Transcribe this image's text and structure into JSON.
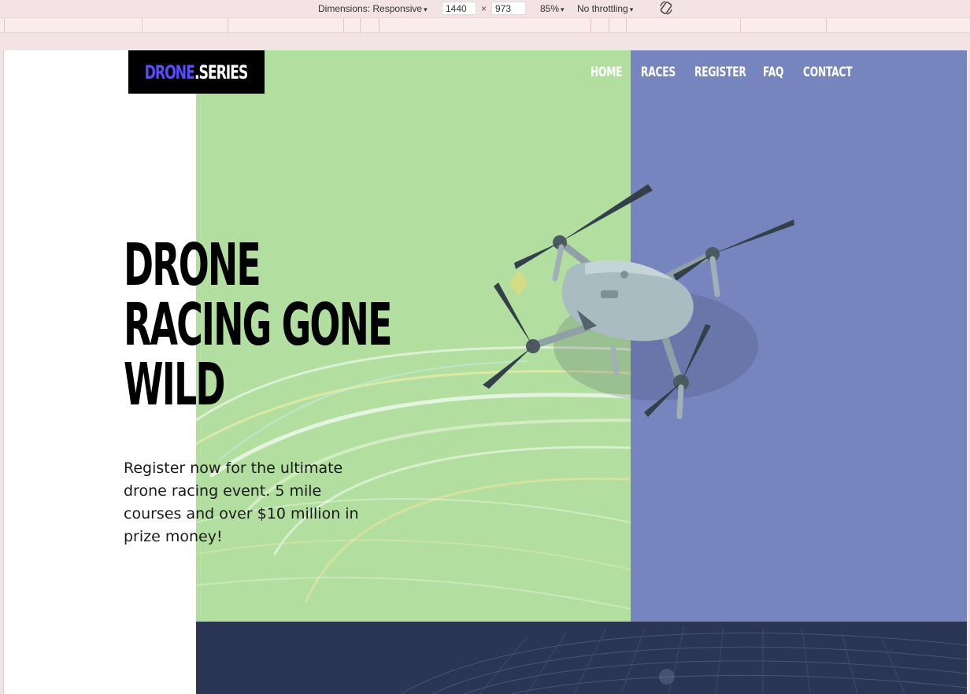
{
  "devtools": {
    "dimensions_label": "Dimensions: Responsive",
    "width_value": "1440",
    "times": "×",
    "height_value": "973",
    "zoom": "85%",
    "throttling": "No throttling",
    "caret": "▾",
    "rotate_icon": "rotate-icon"
  },
  "site": {
    "logo": {
      "part1": "DRONE",
      "part2": ".SERIES"
    },
    "nav": [
      "HOME",
      "RACES",
      "REGISTER",
      "FAQ",
      "CONTACT"
    ],
    "headline": [
      "DRONE",
      "RACING GONE",
      "WILD"
    ],
    "subtext": "Register now for the ultimate drone racing event. 5 mile courses and over $10 million in prize money!",
    "colors": {
      "logo_accent": "#5a4bff",
      "hero_green": "#b2dfa0",
      "hero_blue": "#7785bf",
      "stadium_navy": "#2b3554"
    }
  }
}
